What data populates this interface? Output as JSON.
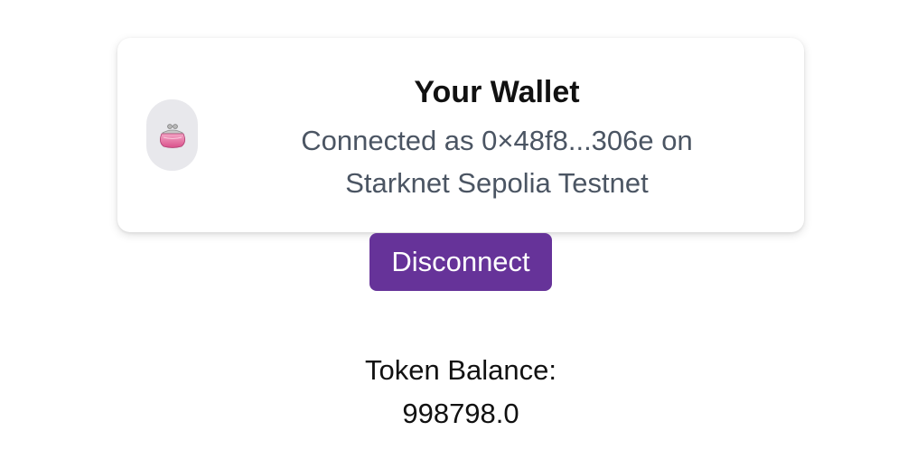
{
  "wallet": {
    "title": "Your Wallet",
    "connected_line_1": "Connected as 0×48f8...306e on",
    "connected_line_2": "Starknet Sepolia Testnet",
    "icon": "purse-icon"
  },
  "actions": {
    "disconnect_label": "Disconnect"
  },
  "balance": {
    "label": "Token Balance:",
    "value": "998798.0"
  },
  "colors": {
    "accent": "#663399",
    "subtitle": "#4b5563",
    "avatar_bg": "#e8e8ec"
  }
}
